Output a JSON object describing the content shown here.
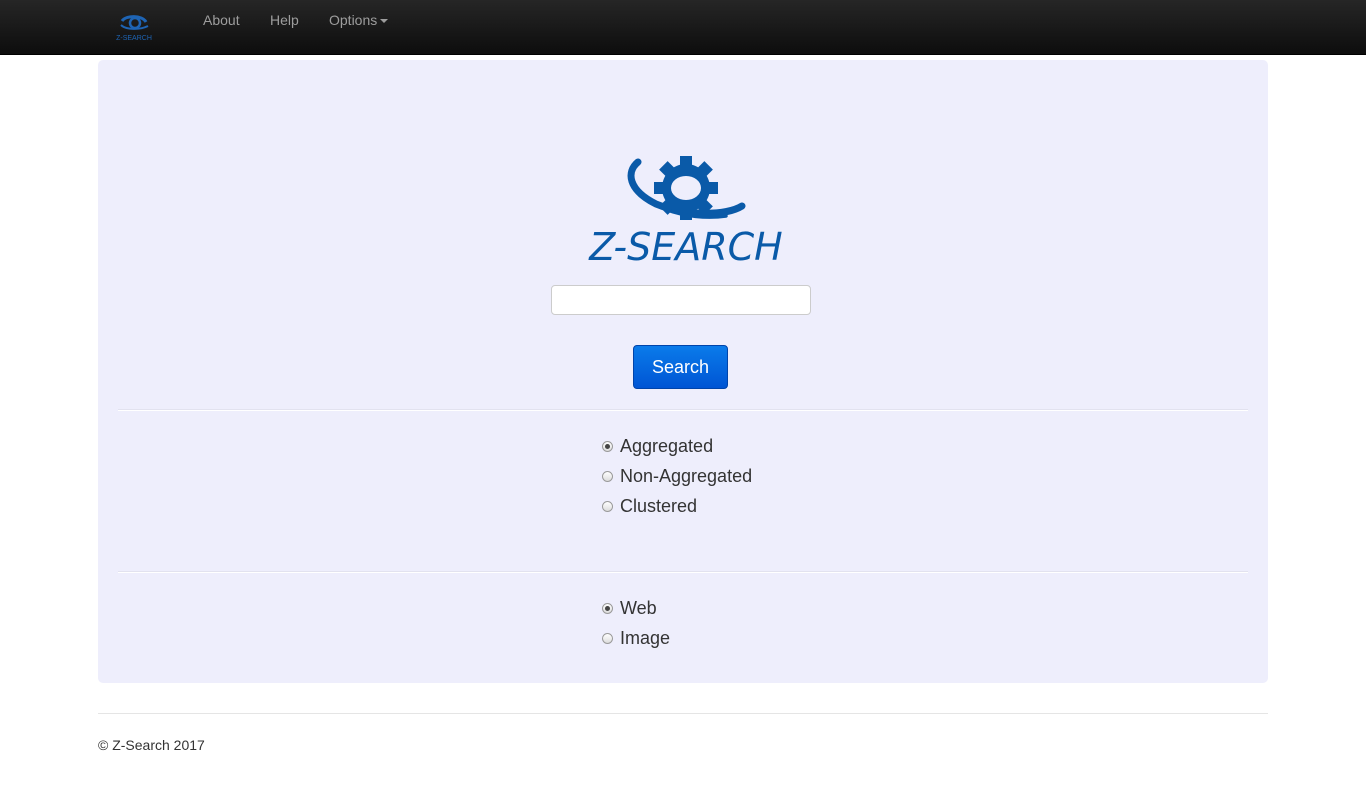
{
  "nav": {
    "brand_text": "Z-SEARCH",
    "links": [
      {
        "label": "About"
      },
      {
        "label": "Help"
      },
      {
        "label": "Options"
      }
    ]
  },
  "logo": {
    "text": "Z-SEARCH",
    "color": "#0a5aa8"
  },
  "search": {
    "value": "",
    "placeholder": "",
    "button_label": "Search"
  },
  "result_mode": {
    "options": [
      {
        "label": "Aggregated",
        "checked": true
      },
      {
        "label": "Non-Aggregated",
        "checked": false
      },
      {
        "label": "Clustered",
        "checked": false
      }
    ]
  },
  "content_type": {
    "options": [
      {
        "label": "Web",
        "checked": true
      },
      {
        "label": "Image",
        "checked": false
      }
    ]
  },
  "footer": {
    "text": "© Z-Search 2017"
  },
  "colors": {
    "navbar": "#1a1a1a",
    "panel": "#eeeefc",
    "brand_blue": "#0a5aa8",
    "button": "#0a6de0"
  }
}
